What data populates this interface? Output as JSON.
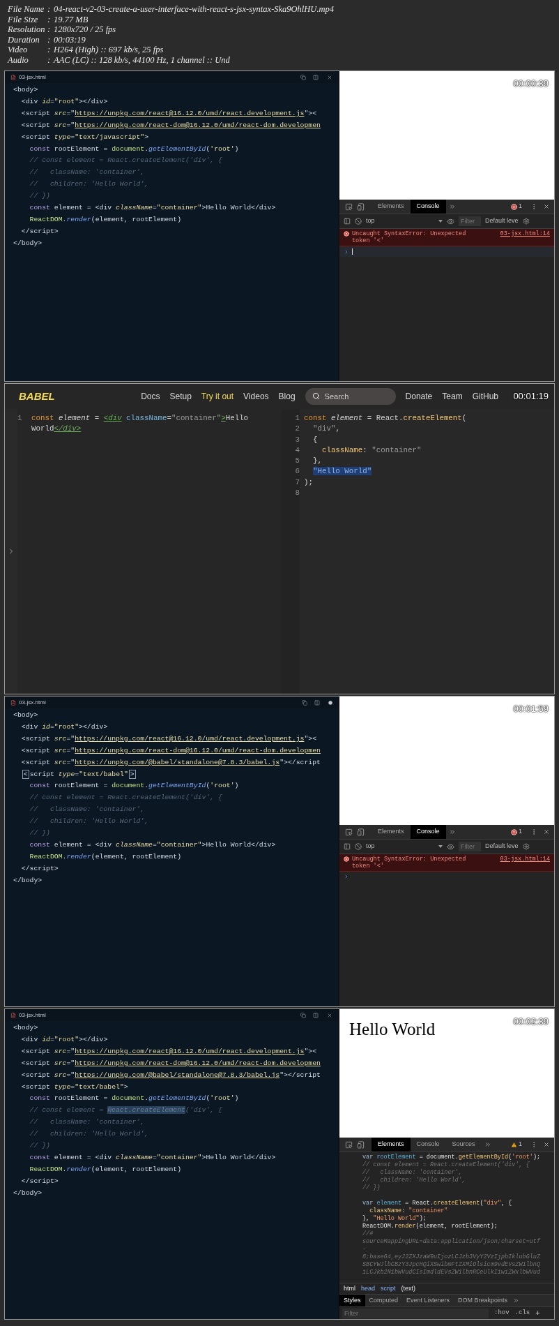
{
  "file_info": [
    {
      "label": "File Name",
      "separator": ":",
      "value": "04-react-v2-03-create-a-user-interface-with-react-s-jsx-syntax-Ska9OhlHU.mp4"
    },
    {
      "label": "File Size",
      "separator": ":",
      "value": "19.77 MB"
    },
    {
      "label": "Resolution",
      "separator": ":",
      "value": "1280x720 / 25 fps"
    },
    {
      "label": "Duration",
      "separator": ":",
      "value": "00:03:19"
    },
    {
      "label": "Video",
      "separator": ":",
      "value": "H264 (High) :: 697 kb/s, 25 fps"
    },
    {
      "label": "Audio",
      "separator": ":",
      "value": "AAC (LC) :: 128 kb/s, 44100 Hz, 1 channel :: Und"
    }
  ],
  "frames": [
    {
      "kind": "editor_devtools",
      "timestamp": "00:00:39",
      "editor": {
        "tab": "03-jsx.html",
        "modified": false,
        "lines": [
          [
            {
              "kind": "plain",
              "text": "<body>"
            }
          ],
          [
            {
              "kind": "plain",
              "text": "  <div "
            },
            {
              "kind": "attr",
              "text": "id"
            },
            {
              "kind": "plain",
              "text": "="
            },
            {
              "kind": "string",
              "text": "\"root\""
            },
            {
              "kind": "plain",
              "text": "></div>"
            }
          ],
          [
            {
              "kind": "plain",
              "text": "  <script "
            },
            {
              "kind": "attr",
              "text": "src"
            },
            {
              "kind": "plain",
              "text": "=\""
            },
            {
              "kind": "link",
              "text": "https://unpkg.com/react@16.12.0/umd/react.development.js"
            },
            {
              "kind": "plain",
              "text": "\"><"
            }
          ],
          [
            {
              "kind": "plain",
              "text": "  <script "
            },
            {
              "kind": "attr",
              "text": "src"
            },
            {
              "kind": "plain",
              "text": "=\""
            },
            {
              "kind": "link",
              "text": "https://unpkg.com/react-dom@16.12.0/umd/react-dom.developmen"
            }
          ],
          [
            {
              "kind": "plain",
              "text": "  <script "
            },
            {
              "kind": "attr",
              "text": "type"
            },
            {
              "kind": "plain",
              "text": "="
            },
            {
              "kind": "string",
              "text": "\"text/javascript\""
            },
            {
              "kind": "plain",
              "text": ">"
            }
          ],
          [
            {
              "kind": "keyword",
              "text": "    const"
            },
            {
              "kind": "plain",
              "text": " rootElement = "
            },
            {
              "kind": "object",
              "text": "document"
            },
            {
              "kind": "plain",
              "text": "."
            },
            {
              "kind": "method",
              "text": "getElementById"
            },
            {
              "kind": "plain",
              "text": "("
            },
            {
              "kind": "string",
              "text": "'root'"
            },
            {
              "kind": "plain",
              "text": ")"
            }
          ],
          [
            {
              "kind": "comment",
              "text": "    // const element = React.createElement('div', {"
            }
          ],
          [
            {
              "kind": "comment",
              "text": "    //   className: 'container',"
            }
          ],
          [
            {
              "kind": "comment",
              "text": "    //   children: 'Hello World',"
            }
          ],
          [
            {
              "kind": "comment",
              "text": "    // })"
            }
          ],
          [
            {
              "kind": "keyword",
              "text": "    const"
            },
            {
              "kind": "plain",
              "text": " element = <div "
            },
            {
              "kind": "attr",
              "text": "className"
            },
            {
              "kind": "plain",
              "text": "="
            },
            {
              "kind": "string",
              "text": "\"container\""
            },
            {
              "kind": "plain",
              "text": ">Hello World</div>"
            }
          ],
          [
            {
              "kind": "object",
              "text": "    ReactDOM"
            },
            {
              "kind": "plain",
              "text": "."
            },
            {
              "kind": "method",
              "text": "render"
            },
            {
              "kind": "plain",
              "text": "(element, rootElement)"
            }
          ],
          [
            {
              "kind": "plain",
              "text": "  </script>"
            }
          ],
          [
            {
              "kind": "plain",
              "text": "</body>"
            }
          ]
        ]
      },
      "devtools": {
        "kind": "console",
        "tabs": [
          {
            "label": "Elements",
            "selected": false
          },
          {
            "label": "Console",
            "selected": true
          }
        ],
        "badge": {
          "kind": "error",
          "count": "1"
        },
        "context": "top",
        "filter_placeholder": "Filter",
        "levels": "Default leve",
        "messages": [
          {
            "text": "Uncaught SyntaxError: Unexpected token '<'",
            "source": "03-jsx.html:14"
          }
        ],
        "focused": true
      }
    },
    {
      "kind": "babel",
      "timestamp": "00:01:19",
      "logo": "BABEL",
      "nav": [
        {
          "label": "Docs",
          "selected": false
        },
        {
          "label": "Setup",
          "selected": false
        },
        {
          "label": "Try it out",
          "selected": true
        },
        {
          "label": "Videos",
          "selected": false
        },
        {
          "label": "Blog",
          "selected": false
        }
      ],
      "search_placeholder": "Search",
      "nav_right": [
        "Donate",
        "Team",
        "GitHub"
      ],
      "input": [
        {
          "number": "1",
          "tokens": [
            {
              "kind": "keyword",
              "text": "const"
            },
            {
              "kind": "variable",
              "text": " element"
            },
            {
              "kind": "plain",
              "text": " = "
            },
            {
              "kind": "tag",
              "text": "<div"
            },
            {
              "kind": "attr",
              "text": " className"
            },
            {
              "kind": "plain",
              "text": "="
            },
            {
              "kind": "string",
              "text": "\"container\""
            },
            {
              "kind": "tag",
              "text": ">"
            },
            {
              "kind": "plain",
              "text": "Hello"
            }
          ]
        },
        {
          "tokens": [
            {
              "kind": "plain",
              "text": "World"
            },
            {
              "kind": "tag",
              "text": "</div>"
            }
          ]
        }
      ],
      "output": [
        {
          "number": "1",
          "tokens": [
            {
              "kind": "keyword",
              "text": "const"
            },
            {
              "kind": "variable",
              "text": " element"
            },
            {
              "kind": "plain",
              "text": " = React."
            },
            {
              "kind": "method",
              "text": "createElement"
            },
            {
              "kind": "plain",
              "text": "("
            }
          ]
        },
        {
          "number": "2",
          "tokens": [
            {
              "kind": "string",
              "text": "  \"div\""
            },
            {
              "kind": "plain",
              "text": ","
            }
          ]
        },
        {
          "number": "3",
          "tokens": [
            {
              "kind": "plain",
              "text": "  {"
            }
          ]
        },
        {
          "number": "4",
          "tokens": [
            {
              "kind": "property",
              "text": "    className"
            },
            {
              "kind": "plain",
              "text": ": "
            },
            {
              "kind": "string",
              "text": "\"container\""
            }
          ]
        },
        {
          "number": "5",
          "tokens": [
            {
              "kind": "plain",
              "text": "  },"
            }
          ]
        },
        {
          "number": "6",
          "tokens": [
            {
              "kind": "selection",
              "text": "  \"Hello World\""
            }
          ]
        },
        {
          "number": "7",
          "tokens": [
            {
              "kind": "plain",
              "text": ");"
            }
          ]
        },
        {
          "number": "8"
        }
      ]
    },
    {
      "kind": "editor_devtools",
      "timestamp": "00:01:59",
      "editor": {
        "tab": "03-jsx.html",
        "modified": true,
        "lines": [
          [
            {
              "kind": "plain",
              "text": "<body>"
            }
          ],
          [
            {
              "kind": "plain",
              "text": "  <div "
            },
            {
              "kind": "attr",
              "text": "id"
            },
            {
              "kind": "plain",
              "text": "="
            },
            {
              "kind": "string",
              "text": "\"root\""
            },
            {
              "kind": "plain",
              "text": "></div>"
            }
          ],
          [
            {
              "kind": "plain",
              "text": "  <script "
            },
            {
              "kind": "attr",
              "text": "src"
            },
            {
              "kind": "plain",
              "text": "=\""
            },
            {
              "kind": "link",
              "text": "https://unpkg.com/react@16.12.0/umd/react.development.js"
            },
            {
              "kind": "plain",
              "text": "\"><"
            }
          ],
          [
            {
              "kind": "plain",
              "text": "  <script "
            },
            {
              "kind": "attr",
              "text": "src"
            },
            {
              "kind": "plain",
              "text": "=\""
            },
            {
              "kind": "link",
              "text": "https://unpkg.com/react-dom@16.12.0/umd/react-dom.developmen"
            }
          ],
          [
            {
              "kind": "plain",
              "text": "  <script "
            },
            {
              "kind": "attr",
              "text": "src"
            },
            {
              "kind": "plain",
              "text": "=\""
            },
            {
              "kind": "link",
              "text": "https://unpkg.com/@babel/standalone@7.8.3/babel.js"
            },
            {
              "kind": "plain",
              "text": "\"></script"
            }
          ],
          [
            {
              "kind": "bracket",
              "text": "  <"
            },
            {
              "kind": "plain",
              "text": "script "
            },
            {
              "kind": "attr",
              "text": "type"
            },
            {
              "kind": "plain",
              "text": "="
            },
            {
              "kind": "string",
              "text": "\"text/babel\""
            },
            {
              "kind": "bracket",
              "text": ">"
            }
          ],
          [
            {
              "kind": "keyword",
              "text": "    const"
            },
            {
              "kind": "plain",
              "text": " rootElement = "
            },
            {
              "kind": "object",
              "text": "document"
            },
            {
              "kind": "plain",
              "text": "."
            },
            {
              "kind": "method",
              "text": "getElementById"
            },
            {
              "kind": "plain",
              "text": "("
            },
            {
              "kind": "string",
              "text": "'root'"
            },
            {
              "kind": "plain",
              "text": ")"
            }
          ],
          [
            {
              "kind": "comment",
              "text": "    // const element = React.createElement('div', {"
            }
          ],
          [
            {
              "kind": "comment",
              "text": "    //   className: 'container',"
            }
          ],
          [
            {
              "kind": "comment",
              "text": "    //   children: 'Hello World',"
            }
          ],
          [
            {
              "kind": "comment",
              "text": "    // })"
            }
          ],
          [
            {
              "kind": "keyword",
              "text": "    const"
            },
            {
              "kind": "plain",
              "text": " element = <div "
            },
            {
              "kind": "attr",
              "text": "className"
            },
            {
              "kind": "plain",
              "text": "="
            },
            {
              "kind": "string",
              "text": "\"container\""
            },
            {
              "kind": "plain",
              "text": ">Hello World</div>"
            }
          ],
          [
            {
              "kind": "object",
              "text": "    ReactDOM"
            },
            {
              "kind": "plain",
              "text": "."
            },
            {
              "kind": "method",
              "text": "render"
            },
            {
              "kind": "plain",
              "text": "(element, rootElement)"
            }
          ],
          [
            {
              "kind": "plain",
              "text": "  </script>"
            }
          ],
          [
            {
              "kind": "plain",
              "text": "</body>"
            }
          ]
        ]
      },
      "devtools": {
        "kind": "console",
        "tabs": [
          {
            "label": "Elements",
            "selected": false
          },
          {
            "label": "Console",
            "selected": true
          }
        ],
        "badge": {
          "kind": "error",
          "count": "1"
        },
        "context": "top",
        "filter_placeholder": "Filter",
        "levels": "Default leve",
        "messages": [
          {
            "text": "Uncaught SyntaxError: Unexpected token '<'",
            "source": "03-jsx.html:14"
          }
        ],
        "focused": false
      }
    },
    {
      "kind": "editor_devtools",
      "timestamp": "00:02:39",
      "editor": {
        "tab": "03-jsx.html",
        "modified": false,
        "lines": [
          [
            {
              "kind": "plain",
              "text": "<body>"
            }
          ],
          [
            {
              "kind": "plain",
              "text": "  <div "
            },
            {
              "kind": "attr",
              "text": "id"
            },
            {
              "kind": "plain",
              "text": "="
            },
            {
              "kind": "string",
              "text": "\"root\""
            },
            {
              "kind": "plain",
              "text": "></div>"
            }
          ],
          [
            {
              "kind": "plain",
              "text": "  <script "
            },
            {
              "kind": "attr",
              "text": "src"
            },
            {
              "kind": "plain",
              "text": "=\""
            },
            {
              "kind": "link",
              "text": "https://unpkg.com/react@16.12.0/umd/react.development.js"
            },
            {
              "kind": "plain",
              "text": "\"><"
            }
          ],
          [
            {
              "kind": "plain",
              "text": "  <script "
            },
            {
              "kind": "attr",
              "text": "src"
            },
            {
              "kind": "plain",
              "text": "=\""
            },
            {
              "kind": "link",
              "text": "https://unpkg.com/react-dom@16.12.0/umd/react-dom.developmen"
            }
          ],
          [
            {
              "kind": "plain",
              "text": "  <script "
            },
            {
              "kind": "attr",
              "text": "src"
            },
            {
              "kind": "plain",
              "text": "=\""
            },
            {
              "kind": "link",
              "text": "https://unpkg.com/@babel/standalone@7.8.3/babel.js"
            },
            {
              "kind": "plain",
              "text": "\"></script"
            }
          ],
          [
            {
              "kind": "plain",
              "text": "  <script "
            },
            {
              "kind": "attr",
              "text": "type"
            },
            {
              "kind": "plain",
              "text": "="
            },
            {
              "kind": "string",
              "text": "\"text/babel\""
            },
            {
              "kind": "plain",
              "text": ">"
            }
          ],
          [
            {
              "kind": "keyword",
              "text": "    const"
            },
            {
              "kind": "plain",
              "text": " rootElement = "
            },
            {
              "kind": "object",
              "text": "document"
            },
            {
              "kind": "plain",
              "text": "."
            },
            {
              "kind": "method",
              "text": "getElementById"
            },
            {
              "kind": "plain",
              "text": "("
            },
            {
              "kind": "string",
              "text": "'root'"
            },
            {
              "kind": "plain",
              "text": ")"
            }
          ],
          [
            {
              "kind": "comment",
              "text": "    // const element = "
            },
            {
              "kind": "selection",
              "text": "React.createElement"
            },
            {
              "kind": "comment",
              "text": "('div', {"
            }
          ],
          [
            {
              "kind": "comment",
              "text": "    //   className: 'container',"
            }
          ],
          [
            {
              "kind": "comment",
              "text": "    //   children: 'Hello World',"
            }
          ],
          [
            {
              "kind": "comment",
              "text": "    // })"
            }
          ],
          [
            {
              "kind": "keyword",
              "text": "    const"
            },
            {
              "kind": "plain",
              "text": " element = <div "
            },
            {
              "kind": "attr",
              "text": "className"
            },
            {
              "kind": "plain",
              "text": "="
            },
            {
              "kind": "string",
              "text": "\"container\""
            },
            {
              "kind": "plain",
              "text": ">Hello World</div>"
            }
          ],
          [
            {
              "kind": "object",
              "text": "    ReactDOM"
            },
            {
              "kind": "plain",
              "text": "."
            },
            {
              "kind": "method",
              "text": "render"
            },
            {
              "kind": "plain",
              "text": "(element, rootElement)"
            }
          ],
          [
            {
              "kind": "plain",
              "text": "  </script>"
            }
          ],
          [
            {
              "kind": "plain",
              "text": "</body>"
            }
          ]
        ]
      },
      "preview": {
        "heading": "Hello World"
      },
      "devtools": {
        "kind": "elements",
        "tabs": [
          {
            "label": "Elements",
            "selected": true
          },
          {
            "label": "Console",
            "selected": false
          },
          {
            "label": "Sources",
            "selected": false
          }
        ],
        "badge": {
          "kind": "warning",
          "count": "1"
        },
        "lines": [
          [
            {
              "kind": "keyword",
              "text": "var"
            },
            {
              "kind": "variable",
              "text": " rootElement"
            },
            {
              "kind": "plain",
              "text": " = document."
            },
            {
              "kind": "method",
              "text": "getElementById"
            },
            {
              "kind": "plain",
              "text": "("
            },
            {
              "kind": "string",
              "text": "'root'"
            },
            {
              "kind": "plain",
              "text": ");"
            }
          ],
          [
            {
              "kind": "comment",
              "text": "// const element = React.createElement('div', {"
            }
          ],
          [
            {
              "kind": "comment",
              "text": "//   className: 'container',"
            }
          ],
          [
            {
              "kind": "comment",
              "text": "//   children: 'Hello World',"
            }
          ],
          [
            {
              "kind": "comment",
              "text": "// })"
            },
            {
              "kind": "line_break"
            }
          ],
          [
            {
              "kind": "keyword",
              "text": "var"
            },
            {
              "kind": "variable",
              "text": " element"
            },
            {
              "kind": "plain",
              "text": " = React."
            },
            {
              "kind": "method",
              "text": "createElement"
            },
            {
              "kind": "plain",
              "text": "("
            },
            {
              "kind": "string",
              "text": "\"div\""
            },
            {
              "kind": "plain",
              "text": ", {"
            }
          ],
          [
            {
              "kind": "property",
              "text": "  className"
            },
            {
              "kind": "plain",
              "text": ": "
            },
            {
              "kind": "string",
              "text": "\"container\""
            }
          ],
          [
            {
              "kind": "plain",
              "text": "}, "
            },
            {
              "kind": "string",
              "text": "\"Hello World\""
            },
            {
              "kind": "plain",
              "text": ");"
            }
          ],
          [
            {
              "kind": "plain",
              "text": "ReactDOM."
            },
            {
              "kind": "method",
              "text": "render"
            },
            {
              "kind": "plain",
              "text": "(element, rootElement);"
            }
          ],
          [
            {
              "kind": "comment",
              "text": "//#"
            }
          ],
          [
            {
              "kind": "comment",
              "text": "sourceMappingURL=data:application/json;charset=utf"
            }
          ],
          [
            {
              "kind": "comment",
              "text": "-"
            }
          ],
          [
            {
              "kind": "comment",
              "text": "8;base64,eyJ2ZXJzaW9uIjozLCJzb3VyY2VzIjpbIklubGluZ"
            }
          ],
          [
            {
              "kind": "comment",
              "text": "SBCYWJlbCBzY3JpcHQiXSwibmFtZXMiOlsicm9vdEVsZW1lbnQ"
            }
          ],
          [
            {
              "kind": "comment",
              "text": "iLCJkb2N1bWVudCIsImdldEVsZW1lbnRCeUlkIiwiZWxlbWVud"
            }
          ]
        ],
        "breadcrumbs": [
          "html",
          "head",
          "script",
          "(text)"
        ],
        "subtabs": [
          {
            "label": "Styles",
            "selected": true
          },
          {
            "label": "Computed",
            "selected": false
          },
          {
            "label": "Event Listeners",
            "selected": false
          },
          {
            "label": "DOM Breakpoints",
            "selected": false
          }
        ],
        "filter_placeholder": "Filter",
        "hov": ":hov",
        "cls": ".cls",
        "add": "+"
      }
    }
  ]
}
